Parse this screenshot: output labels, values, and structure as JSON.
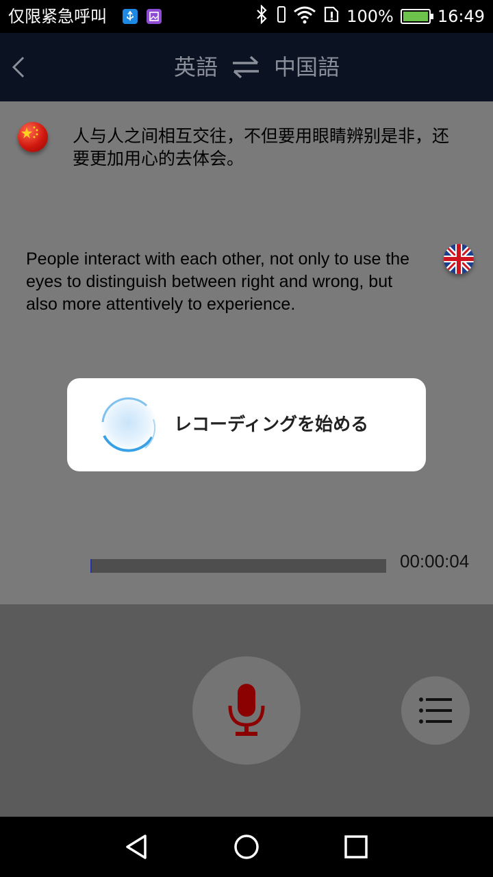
{
  "status_bar": {
    "carrier": "仅限紧急呼叫",
    "battery": "100%",
    "time": "16:49",
    "icons": [
      "usb-icon",
      "gallery-icon",
      "bluetooth-icon",
      "wifi-icon",
      "sim-icon",
      "battery-icon"
    ]
  },
  "header": {
    "source_lang": "英語",
    "target_lang": "中国語",
    "icons": [
      "back-icon",
      "swap-icon"
    ],
    "color": "#0b1222"
  },
  "conversation": {
    "source_text": "人与人之间相互交往，不但要用眼睛辨别是非，还要更加用心的去体会。",
    "target_text": "People interact with each other, not only to use the eyes to distinguish between right and wrong, but also more attentively to experience.",
    "source_flag": "china-flag-icon",
    "target_flag": "uk-flag-icon"
  },
  "playback": {
    "time": "00:00:04",
    "progress_fraction": 0.0
  },
  "dialog": {
    "message": "レコーディングを始める",
    "icon": "recording-spinner-icon"
  },
  "controls": {
    "mic_icon": "microphone-icon",
    "menu_icon": "menu-icon",
    "mic_color": "#8b0000"
  },
  "nav_bar": {
    "icons": [
      "back-triangle-icon",
      "home-circle-icon",
      "recents-square-icon"
    ]
  }
}
